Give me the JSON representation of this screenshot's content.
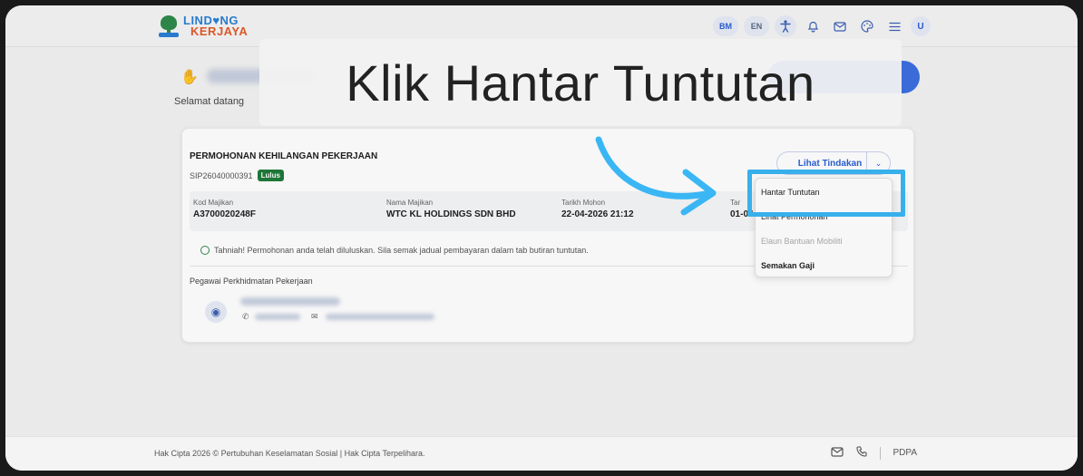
{
  "header": {
    "logo_line1": "LIND♥NG",
    "logo_line2": "KERJAYA",
    "lang_bm": "BM",
    "lang_en": "EN",
    "avatar_initial": "U",
    "icons": [
      "accessibility-icon",
      "bell-icon",
      "mail-icon",
      "palette-icon",
      "menu-icon"
    ]
  },
  "greeting": {
    "subtitle": "Selamat datang"
  },
  "overlay": {
    "instruction": "Klik Hantar Tuntutan"
  },
  "card": {
    "title": "PERMOHONAN KEHILANGAN PEKERJAAN",
    "ref": "SIP26040000391",
    "status": "Lulus",
    "action_button": "Lihat Tindakan",
    "fields": [
      {
        "label": "Kod Majikan",
        "value": "A3700020248F"
      },
      {
        "label": "Nama Majikan",
        "value": "WTC KL HOLDINGS SDN BHD"
      },
      {
        "label": "Tarikh Mohon",
        "value": "22-04-2026 21:12"
      },
      {
        "label": "Tar",
        "value": "01-04"
      }
    ],
    "note": "Tahniah! Permohonan anda telah diluluskan. Sila semak jadual pembayaran dalam tab butiran tuntutan.",
    "officer_title": "Pegawai Perkhidmatan Pekerjaan"
  },
  "dropdown": {
    "items": [
      {
        "label": "Hantar Tuntutan",
        "disabled": false
      },
      {
        "label": "Lihat Permohonan",
        "disabled": false
      },
      {
        "label": "Elaun Bantuan Mobiliti",
        "disabled": true
      },
      {
        "label": "Semakan Gaji",
        "disabled": false
      }
    ]
  },
  "footer": {
    "copyright": "Hak Cipta 2026 © Pertubuhan Keselamatan Sosial | Hak Cipta Terpelihara.",
    "pdpa": "PDPA"
  },
  "colors": {
    "primary": "#2a5fd4",
    "highlight": "#3ab6f4",
    "success": "#1f7a3a"
  }
}
